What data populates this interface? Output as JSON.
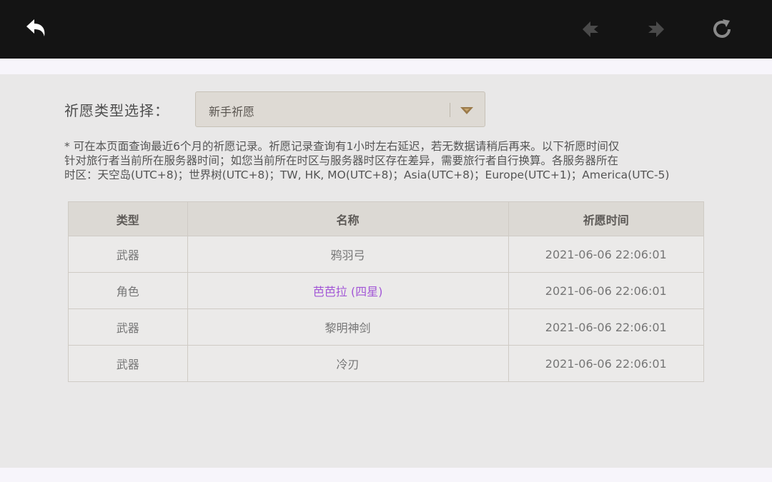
{
  "toolbar": {
    "back_icon": "back-arrow-icon",
    "prev_icon": "prev-diamond-icon",
    "next_icon": "next-diamond-icon",
    "reload_icon": "reload-icon"
  },
  "filter": {
    "label": "祈愿类型选择：",
    "selected": "新手祈愿",
    "dropdown_icon": "chevron-down-icon",
    "accent_color": "#9b7a4a"
  },
  "notice": {
    "lines": [
      "* 可在本页面查询最近6个月的祈愿记录。祈愿记录查询有1小时左右延迟，若无数据请稍后再来。以下祈愿时间仅",
      "针对旅行者当前所在服务器时间；如您当前所在时区与服务器时区存在差异，需要旅行者自行换算。各服务器所在",
      "时区：天空岛(UTC+8)；世界树(UTC+8)；TW, HK, MO(UTC+8)；Asia(UTC+8)；Europe(UTC+1)；America(UTC-5)"
    ]
  },
  "table": {
    "headers": [
      "类型",
      "名称",
      "祈愿时间"
    ],
    "rows": [
      [
        "武器",
        "鸦羽弓",
        "2021-06-06 22:06:01"
      ],
      [
        "角色",
        "芭芭拉 (四星)",
        "2021-06-06 22:06:01"
      ],
      [
        "武器",
        "黎明神剑",
        "2021-06-06 22:06:01"
      ],
      [
        "武器",
        "冷刃",
        "2021-06-06 22:06:01"
      ]
    ],
    "four_star_color": "#a256d6"
  }
}
